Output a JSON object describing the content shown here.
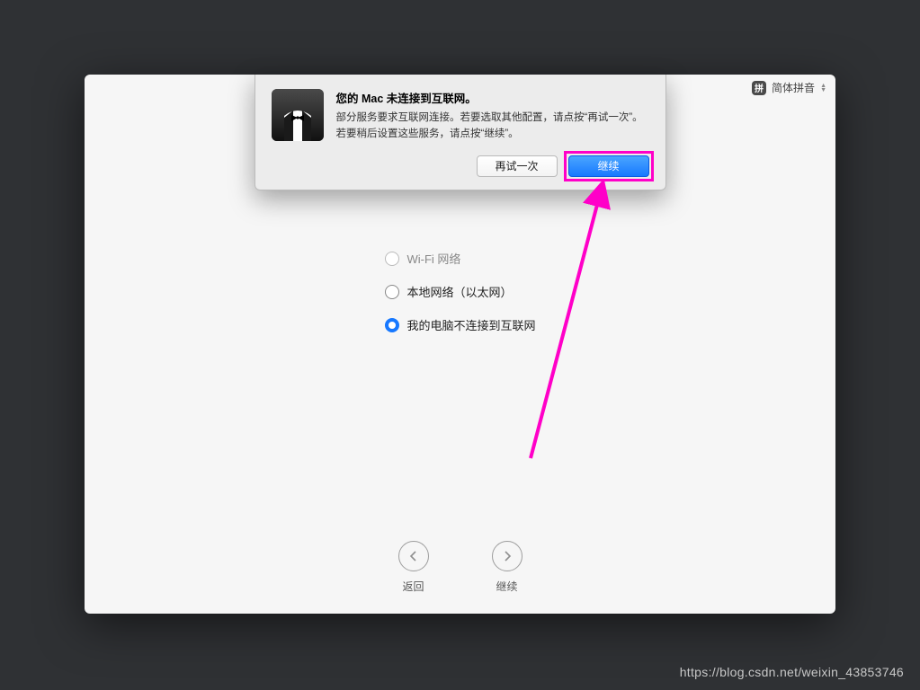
{
  "ime": {
    "badge": "拼",
    "label": "简体拼音"
  },
  "sheet": {
    "title": "您的 Mac 未连接到互联网。",
    "body": "部分服务要求互联网连接。若要选取其他配置，请点按“再试一次”。若要稍后设置这些服务，请点按“继续”。",
    "retry": "再试一次",
    "cont": "继续"
  },
  "radios": {
    "wifi": "Wi-Fi 网络",
    "ethernet": "本地网络（以太网）",
    "none": "我的电脑不连接到互联网"
  },
  "nav": {
    "back": "返回",
    "continue": "继续"
  },
  "watermark": "https://blog.csdn.net/weixin_43853746"
}
